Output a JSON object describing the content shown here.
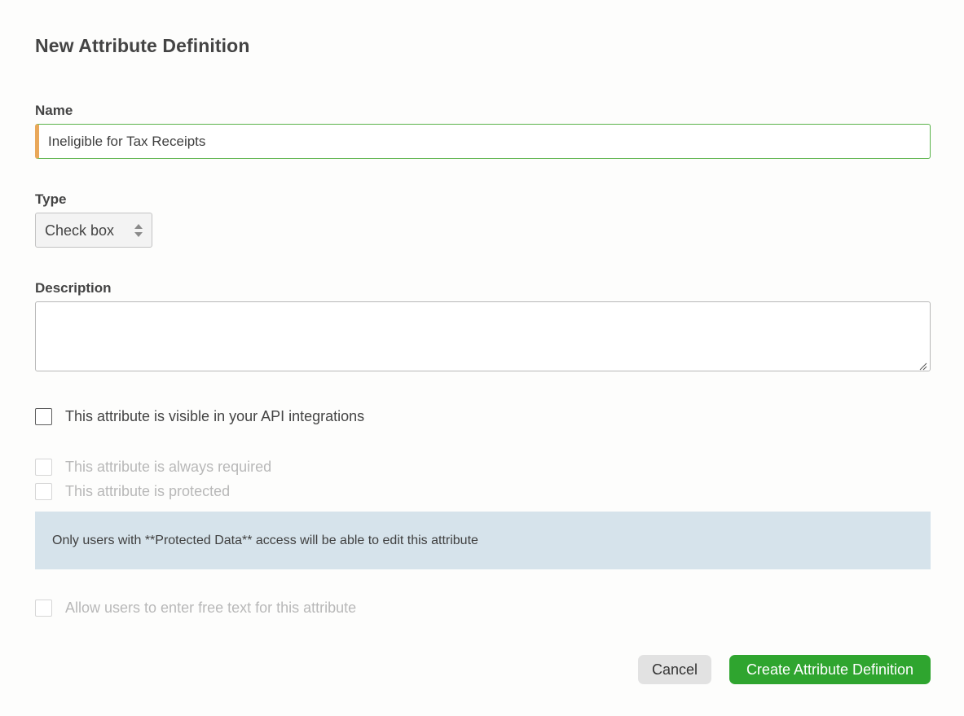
{
  "dialog": {
    "title": "New Attribute Definition"
  },
  "fields": {
    "name_label": "Name",
    "name_value": "Ineligible for Tax Receipts",
    "type_label": "Type",
    "type_value": "Check box",
    "description_label": "Description",
    "description_value": ""
  },
  "options": {
    "api_visible": "This attribute is visible in your API integrations",
    "always_required": "This attribute is always required",
    "protected": "This attribute is protected",
    "free_text": "Allow users to enter free text for this attribute"
  },
  "notice": {
    "text": "Only users with **Protected Data** access will be able to edit this attribute"
  },
  "actions": {
    "cancel_label": "Cancel",
    "create_label": "Create Attribute Definition"
  },
  "colors": {
    "accent_green": "#2fa52f",
    "input_focus_border": "#5ab34a",
    "input_left_marker": "#e9a85a",
    "notice_background": "#d6e3eb"
  },
  "icons": {
    "select_arrows": "select-arrows-icon",
    "resize": "resize-handle-icon"
  }
}
